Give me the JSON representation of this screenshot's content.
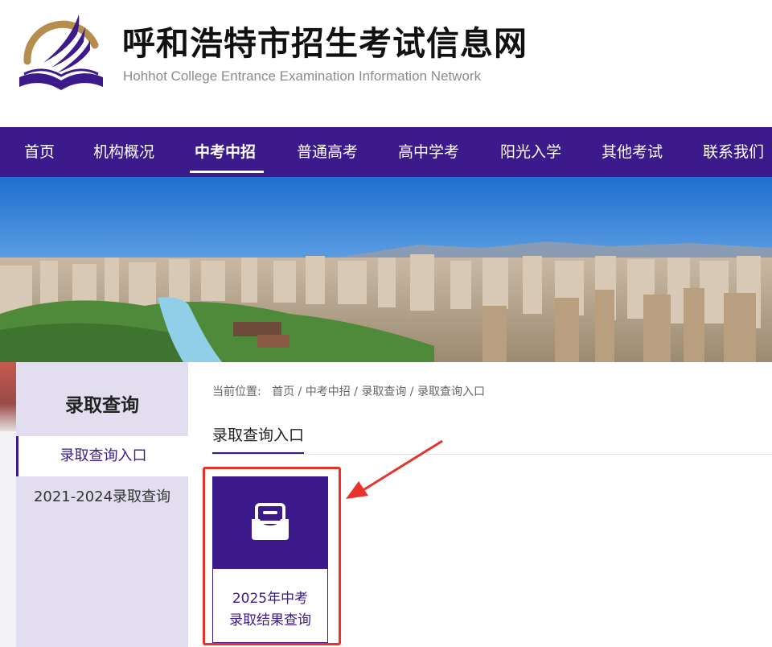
{
  "header": {
    "title": "呼和浩特市招生考试信息网",
    "subtitle": "Hohhot College Entrance Examination Information Network",
    "logo_icon": "book-wing-logo",
    "colors": {
      "logo_purple": "#3d1a8c",
      "logo_gold": "#b58e4e"
    }
  },
  "nav": {
    "items": [
      {
        "label": "首页"
      },
      {
        "label": "机构概况"
      },
      {
        "label": "中考中招",
        "active": true
      },
      {
        "label": "普通高考"
      },
      {
        "label": "高中学考"
      },
      {
        "label": "阳光入学"
      },
      {
        "label": "其他考试"
      },
      {
        "label": "联系我们"
      }
    ],
    "colors": {
      "background": "#3d1a8c",
      "text": "#ffffff"
    }
  },
  "sidebar": {
    "title": "录取查询",
    "items": [
      {
        "label": "录取查询入口",
        "active": true
      },
      {
        "label": "2021-2024录取查询"
      }
    ],
    "colors": {
      "background": "#e3ddf0",
      "active_text": "#3d1a8c"
    }
  },
  "breadcrumb": {
    "prefix": "当前位置:",
    "items": [
      "首页",
      "中考中招",
      "录取查询",
      "录取查询入口"
    ],
    "separator": "/"
  },
  "main": {
    "section_title": "录取查询入口",
    "card": {
      "line1": "2025年中考",
      "line2": "录取结果查询",
      "icon": "envelope-inbox-icon"
    },
    "annotation": {
      "highlight_color": "#e8332d",
      "arrow_icon": "red-arrow-icon"
    }
  }
}
